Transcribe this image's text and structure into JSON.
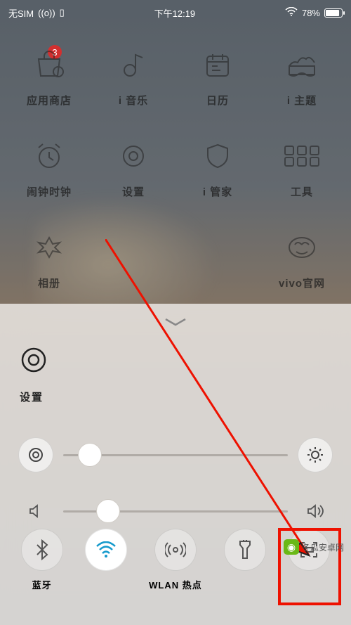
{
  "statusbar": {
    "sim": "无SIM",
    "time": "下午12:19",
    "battery": "78%"
  },
  "badge": "3",
  "apps": [
    {
      "label": "应用商店"
    },
    {
      "label": "i 音乐"
    },
    {
      "label": "日历"
    },
    {
      "label": "i 主题"
    },
    {
      "label": "闹钟时钟"
    },
    {
      "label": "设置"
    },
    {
      "label": "i 管家"
    },
    {
      "label": "工具"
    },
    {
      "label": "相册"
    },
    {
      "label": ""
    },
    {
      "label": ""
    },
    {
      "label": "vivo官网"
    }
  ],
  "panel": {
    "settings_label": "设置"
  },
  "toggles": [
    {
      "label": "蓝牙",
      "on": false
    },
    {
      "label": "",
      "on": true
    },
    {
      "label": "WLAN 热点",
      "on": false
    },
    {
      "label": "",
      "on": false
    },
    {
      "label": "",
      "on": false
    }
  ],
  "watermark": "冬瓜安卓网"
}
